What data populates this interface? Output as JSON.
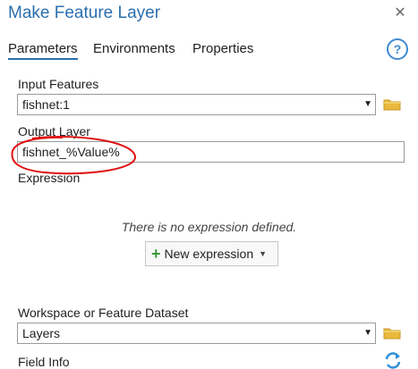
{
  "window": {
    "title": "Make Feature Layer",
    "close_glyph": "✕"
  },
  "tabs": [
    {
      "label": "Parameters",
      "active": true
    },
    {
      "label": "Environments",
      "active": false
    },
    {
      "label": "Properties",
      "active": false
    }
  ],
  "help_glyph": "?",
  "params": {
    "input_features": {
      "label": "Input Features",
      "value": "fishnet:1"
    },
    "output_layer": {
      "label": "Output Layer",
      "value": "fishnet_%Value%"
    },
    "expression": {
      "label": "Expression",
      "empty_message": "There is no expression defined.",
      "new_button": "New expression"
    },
    "workspace": {
      "label": "Workspace or Feature Dataset",
      "value": "Layers"
    },
    "field_info": {
      "label": "Field Info"
    }
  },
  "glyphs": {
    "dropdown": "▼",
    "plus": "+",
    "caret": "▼"
  },
  "colors": {
    "title": "#2c6fae",
    "folder": "#e8b93a",
    "refresh": "#2f8fd8",
    "annotation": "#e01010"
  }
}
